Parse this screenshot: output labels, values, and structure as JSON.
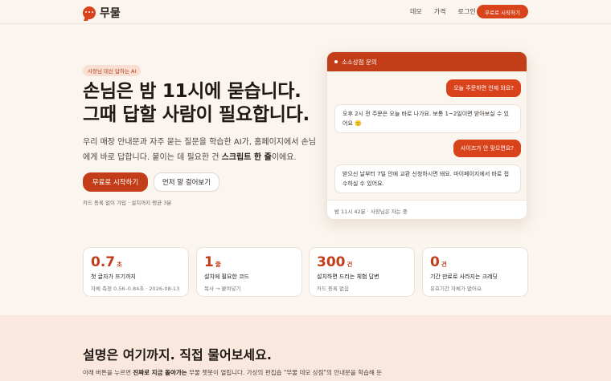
{
  "brand": {
    "name": "무물",
    "accent": "#d8431c"
  },
  "nav": {
    "links": [
      "데모",
      "가격",
      "로그인"
    ],
    "cta": "무료로 시작하기"
  },
  "hero": {
    "badge": "사장님 대신 답하는 AI",
    "headline_1": "손님은 밤 11시에 묻습니다.",
    "headline_2": "그때 답할 사람이 필요합니다.",
    "desc_part1": "우리 매장 안내문과 자주 묻는 질문을 학습한 AI가, 홈페이지에서 손님에게 바로 답합니다. 붙이는 데 필요한 건 ",
    "desc_bold": "스크립트 한 줄",
    "desc_part2": "이에요.",
    "primary_button": "무료로 시작하기",
    "secondary_button": "먼저 말 걸어보기",
    "note": "카드 등록 없이 가입 · 설치까지 평균 3분"
  },
  "chat": {
    "title": "소소상점 문의",
    "messages": [
      {
        "role": "user",
        "text": "오늘 주문하면 언제 와요?"
      },
      {
        "role": "bot",
        "text": "오후 2시 전 주문은 오늘 바로 나가요. 보통 1~2일이면 받아보실 수 있어요 🙂"
      },
      {
        "role": "user",
        "text": "사이즈가 안 맞으면요?"
      },
      {
        "role": "bot",
        "text": "받으신 날부터 7일 안에 교환 신청하시면 돼요. 마이페이지에서 바로 접수하실 수 있어요."
      }
    ],
    "footer": "밤 11시 42분 · 사장님은 자는 중"
  },
  "stats": [
    {
      "value": "0.7",
      "unit": "초",
      "label": "첫 글자가 뜨기까지",
      "sub": "자체 측정 0.56–0.84초 · 2026-08-13"
    },
    {
      "value": "1",
      "unit": "줄",
      "label": "설치에 필요한 코드",
      "sub": "복사 → 붙여넣기"
    },
    {
      "value": "300",
      "unit": "건",
      "label": "설치하면 드리는 체험 답변",
      "sub": "카드 등록 없음"
    },
    {
      "value": "0",
      "unit": "건",
      "label": "기간 만료로 사라지는 크레딧",
      "sub": "유효기간 자체가 없어요"
    }
  ],
  "bottom": {
    "title": "설명은 여기까지. 직접 물어보세요.",
    "text_part1": "아래 버튼을 누르면 ",
    "text_bold": "진짜로 지금 돌아가는",
    "text_part2": " 무물 챗봇이 열립니다. 가상의 편집숍 \"무물 데모 상점\"의 안내문을 학습해 둔"
  }
}
